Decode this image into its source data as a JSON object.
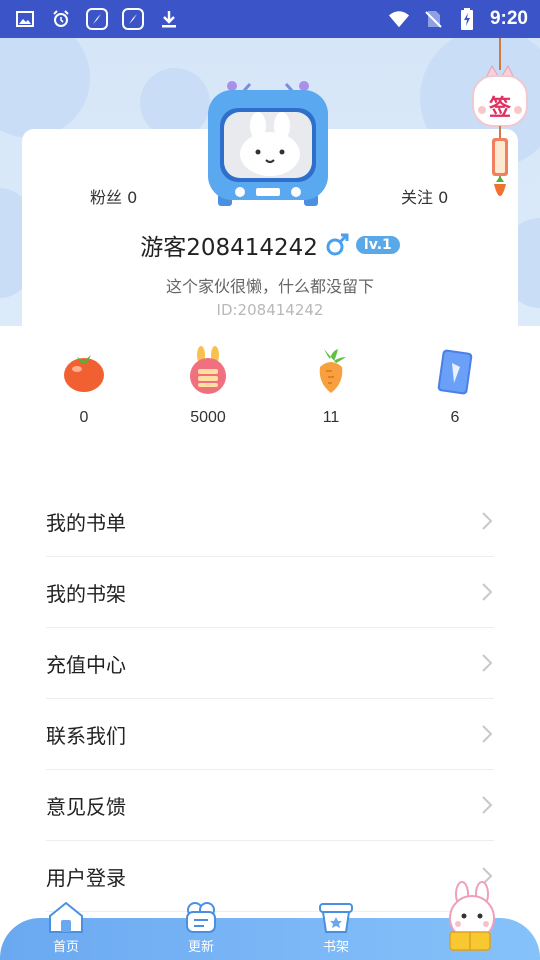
{
  "status_bar": {
    "time": "9:20",
    "left_icons": [
      "image-icon",
      "alarm-icon",
      "compass-icon",
      "compass-icon",
      "download-icon"
    ],
    "right_icons": [
      "wifi-icon",
      "no-sim-icon",
      "battery-charging-icon"
    ]
  },
  "profile": {
    "fans_label": "粉丝 0",
    "follow_label": "关注 0",
    "username": "游客208414242",
    "gender": "male",
    "level": "lv.1",
    "bio": "这个家伙很懒，什么都没留下",
    "id_text": "ID:208414242"
  },
  "sign_in": {
    "label": "签"
  },
  "stats": [
    {
      "icon": "tomato-icon",
      "value": "0"
    },
    {
      "icon": "coin-rabbit-icon",
      "value": "5000"
    },
    {
      "icon": "carrot-icon",
      "value": "11"
    },
    {
      "icon": "card-icon",
      "value": "6"
    }
  ],
  "menu": [
    {
      "label": "我的书单"
    },
    {
      "label": "我的书架"
    },
    {
      "label": "充值中心"
    },
    {
      "label": "联系我们"
    },
    {
      "label": "意见反馈"
    },
    {
      "label": "用户登录"
    }
  ],
  "bottom_nav": [
    {
      "label": "首页",
      "icon": "home-icon"
    },
    {
      "label": "更新",
      "icon": "update-icon"
    },
    {
      "label": "书架",
      "icon": "bookshelf-icon"
    },
    {
      "label": "",
      "icon": "mascot-icon"
    }
  ],
  "colors": {
    "status_bar": "#3b55c8",
    "header_bg": "#d6e6f8",
    "accent": "#5aa8e8",
    "nav_bg": "#7ab6f6"
  }
}
